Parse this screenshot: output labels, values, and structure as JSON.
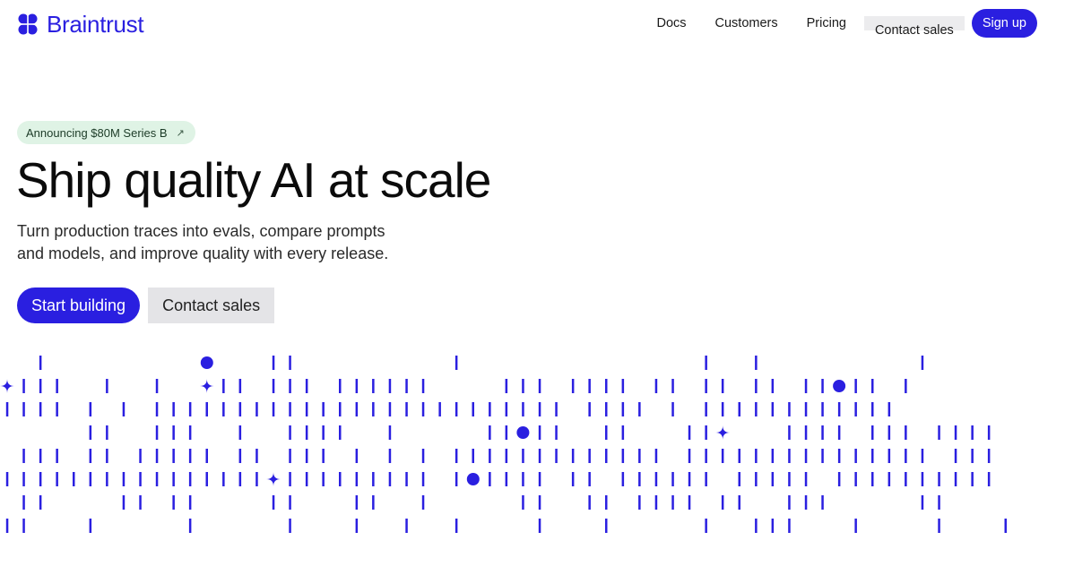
{
  "header": {
    "brand": "Braintrust",
    "nav": {
      "docs": "Docs",
      "customers": "Customers",
      "pricing": "Pricing",
      "contact_sales": "Contact sales",
      "sign_up": "Sign up"
    }
  },
  "hero": {
    "announcement": "Announcing $80M Series B",
    "announcement_icon": "arrow-up-right-icon",
    "title": "Ship quality AI at scale",
    "subtitle": "Turn production traces into evals, compare prompts and models, and improve quality with every release.",
    "cta_primary": "Start building",
    "cta_secondary": "Contact sales"
  },
  "colors": {
    "accent": "#2a1fe0",
    "announce_bg": "#dff3e5",
    "secondary_button_bg": "#e4e4e7"
  },
  "decorative_pattern": {
    "icons": [
      "bar-mark",
      "dot-mark",
      "sparkle-mark"
    ]
  }
}
